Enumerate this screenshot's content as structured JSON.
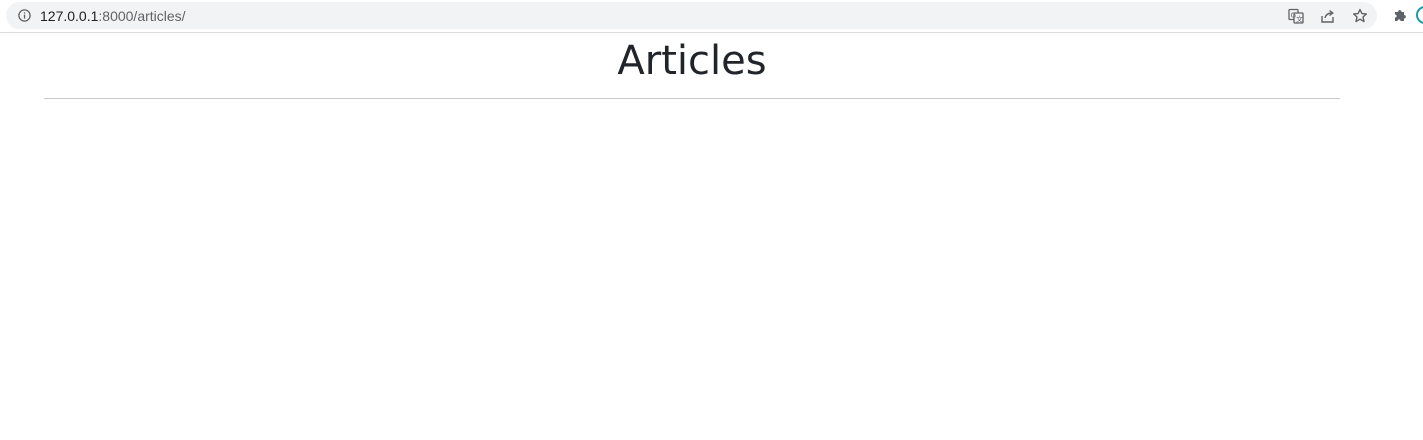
{
  "browser": {
    "url_host": "127.0.0.1",
    "url_rest": ":8000/articles/",
    "icons": [
      "info-icon",
      "translate-icon",
      "share-icon",
      "star-icon",
      "extensions-icon",
      "profile-icon"
    ]
  },
  "page": {
    "title": "Articles"
  },
  "colors": {
    "omnibox_bg": "#f1f3f4",
    "title_text": "#212529",
    "divider": "#c8c8c8",
    "profile_ring": "#1a9aa6"
  }
}
